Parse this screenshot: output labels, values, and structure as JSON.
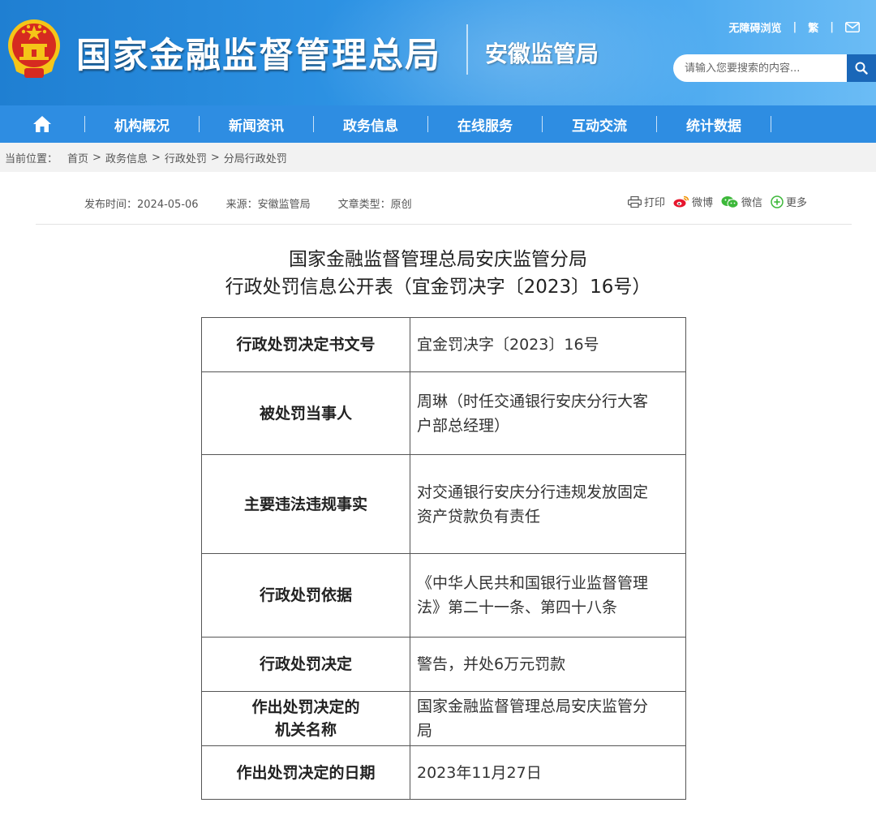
{
  "header": {
    "site_title": "国家金融监督管理总局",
    "sub_title": "安徽监管局",
    "accessibility": "无障碍浏览",
    "traditional": "繁",
    "separator": "|",
    "search_placeholder": "请输入您要搜索的内容..."
  },
  "nav": {
    "items": [
      "机构概况",
      "新闻资讯",
      "政务信息",
      "在线服务",
      "互动交流",
      "统计数据"
    ]
  },
  "breadcrumb": {
    "label": "当前位置：",
    "items": [
      "首页",
      "政务信息",
      "行政处罚",
      "分局行政处罚"
    ],
    "sep": ">"
  },
  "meta": {
    "publish": "发布时间：2024-05-06",
    "source": "来源：安徽监管局",
    "type": "文章类型：原创",
    "print": "打印",
    "weibo": "微博",
    "wechat": "微信",
    "more": "更多"
  },
  "document": {
    "title_line1": "国家金融监督管理总局安庆监管分局",
    "title_line2": "行政处罚信息公开表（宜金罚决字〔2023〕16号）"
  },
  "table": {
    "rows": [
      {
        "key_lines": [
          "行政处罚决定书文号"
        ],
        "value_lines": [
          "宜金罚决字〔2023〕16号"
        ]
      },
      {
        "key_lines": [
          "被处罚当事人"
        ],
        "value_lines": [
          "周琳（时任交通银行安庆分行大客",
          "户部总经理）"
        ]
      },
      {
        "key_lines": [
          "主要违法违规事实"
        ],
        "value_lines": [
          "对交通银行安庆分行违规发放固定",
          "资产贷款负有责任"
        ]
      },
      {
        "key_lines": [
          "行政处罚依据"
        ],
        "value_lines": [
          "《中华人民共和国银行业监督管理",
          "法》第二十一条、第四十八条"
        ]
      },
      {
        "key_lines": [
          "行政处罚决定"
        ],
        "value_lines": [
          "警告，并处6万元罚款"
        ]
      },
      {
        "key_lines": [
          "作出处罚决定的",
          "机关名称"
        ],
        "value_lines": [
          "国家金融监督管理总局安庆监管分",
          "局"
        ]
      },
      {
        "key_lines": [
          "作出处罚决定的日期"
        ],
        "value_lines": [
          "2023年11月27日"
        ]
      }
    ]
  },
  "colors": {
    "header_blue": "#2f95e6",
    "nav_blue": "#2e8de2",
    "search_button": "#1a67b8",
    "emblem_red": "#d62a20",
    "emblem_gold": "#f5c518"
  },
  "icons": [
    "national-emblem-icon",
    "mail-icon",
    "search-icon",
    "home-icon",
    "print-icon",
    "weibo-icon",
    "wechat-icon",
    "plus-circle-icon"
  ]
}
